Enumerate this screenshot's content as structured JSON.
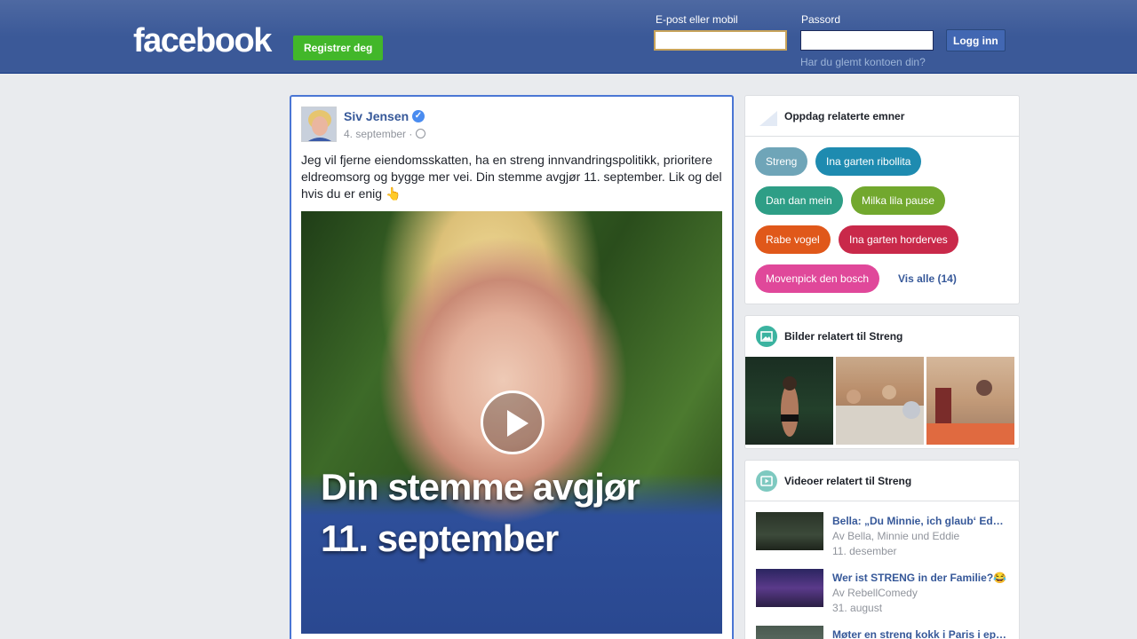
{
  "header": {
    "logo": "facebook",
    "register_label": "Registrer deg",
    "email_label": "E-post eller mobil",
    "email_value": "",
    "password_label": "Passord",
    "password_value": "",
    "login_label": "Logg inn",
    "forgot_label": "Har du glemt kontoen din?"
  },
  "post": {
    "author": "Siv Jensen",
    "verified": true,
    "date": "4. september ·",
    "text": "Jeg vil fjerne eiendomsskatten, ha en streng innvandringspolitikk, prioritere eldreomsorg og bygge mer vei. Din stemme avgjør 11. september. Lik og del hvis du er enig",
    "emoji": "👆",
    "video_caption_line1": "Din stemme avgjør",
    "video_caption_line2": "11. september"
  },
  "related_topics": {
    "title": "Oppdag relaterte emner",
    "chips": [
      {
        "label": "Streng",
        "color": "#6fa5b8"
      },
      {
        "label": "Ina garten ribollita",
        "color": "#1e8bb0"
      },
      {
        "label": "Dan dan mein",
        "color": "#2e9e86"
      },
      {
        "label": "Milka lila pause",
        "color": "#72a82e"
      },
      {
        "label": "Rabe vogel",
        "color": "#e0581a"
      },
      {
        "label": "Ina garten horderves",
        "color": "#c9294a"
      },
      {
        "label": "Movenpick den bosch",
        "color": "#e0489a"
      }
    ],
    "see_all": "Vis alle (14)"
  },
  "related_images": {
    "title": "Bilder relatert til Streng",
    "icon_color": "#3bb3a0"
  },
  "related_videos": {
    "title": "Videoer relatert til Streng",
    "icon_color": "#7ec9c0",
    "items": [
      {
        "title": "Bella: „Du Minnie, ich glaub‘ Ed…",
        "author": "Av Bella, Minnie und Eddie",
        "date": "11. desember"
      },
      {
        "title": "Wer ist STRENG in der Familie?😂",
        "author": "Av RebellComedy",
        "date": "31. august"
      },
      {
        "title": "Møter en streng kokk i Paris i ep…",
        "author": "",
        "date": ""
      }
    ]
  }
}
